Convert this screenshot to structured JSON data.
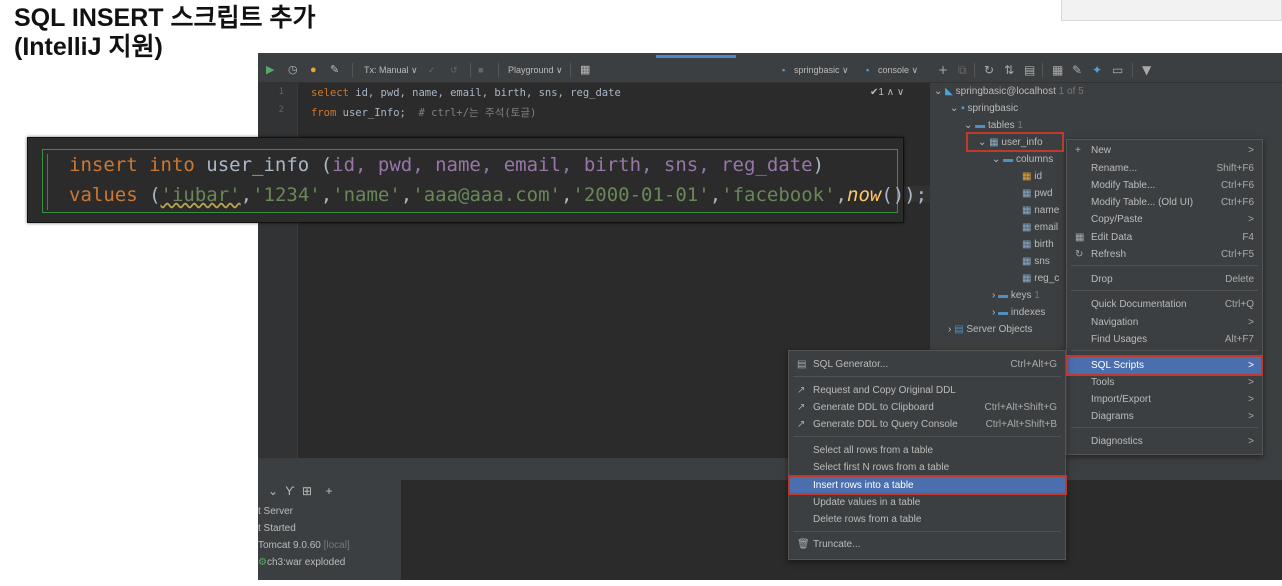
{
  "slide": {
    "title_line1": "SQL INSERT 스크립트 추가",
    "title_line2": "(IntelliJ 지원)"
  },
  "toolbar": {
    "tx_mode": "Tx: Manual ∨",
    "playground": "Playground ∨",
    "datasource": "springbasic ∨",
    "console": "console ∨"
  },
  "editor": {
    "line_numbers": [
      "1",
      "2"
    ],
    "line1": {
      "kw": "select",
      "rest": " id, pwd, name, email, birth, sns, reg_date"
    },
    "line2": {
      "kw": "from",
      "rest": " user_Info;  ",
      "comment": "# ctrl+/는 주석(토글)"
    },
    "inspection": "✔1 ∧ ∨"
  },
  "tree": {
    "connection": "springbasic@localhost",
    "connection_count": "1 of 5",
    "schema": "springbasic",
    "tables_label": "tables",
    "tables_count": "1",
    "table_name": "user_info",
    "columns_label": "columns",
    "columns": [
      "id",
      "pwd",
      "name",
      "email",
      "birth",
      "sns",
      "reg_c"
    ],
    "keys_label": "keys",
    "keys_count": "1",
    "indexes_label": "indexes",
    "server_objects": "Server Objects"
  },
  "services": {
    "rows": [
      "t Server",
      "t Started",
      "Tomcat 9.0.60",
      "[local]",
      "ch3:war exploded"
    ]
  },
  "context_menu": {
    "items": [
      {
        "label": "New",
        "shortcut": ">"
      },
      {
        "label": "Rename...",
        "shortcut": "Shift+F6"
      },
      {
        "label": "Modify Table...",
        "shortcut": "Ctrl+F6"
      },
      {
        "label": "Modify Table... (Old UI)",
        "shortcut": "Ctrl+F6"
      },
      {
        "label": "Copy/Paste",
        "shortcut": ">"
      },
      {
        "label": "Edit Data",
        "shortcut": "F4"
      },
      {
        "label": "Refresh",
        "shortcut": "Ctrl+F5"
      },
      {
        "label": "Drop",
        "shortcut": "Delete"
      },
      {
        "label": "Quick Documentation",
        "shortcut": "Ctrl+Q"
      },
      {
        "label": "Navigation",
        "shortcut": ">"
      },
      {
        "label": "Find Usages",
        "shortcut": "Alt+F7"
      },
      {
        "label": "SQL Scripts",
        "shortcut": ">"
      },
      {
        "label": "Tools",
        "shortcut": ">"
      },
      {
        "label": "Import/Export",
        "shortcut": ">"
      },
      {
        "label": "Diagrams",
        "shortcut": ">"
      },
      {
        "label": "Diagnostics",
        "shortcut": ">"
      }
    ]
  },
  "submenu": {
    "items": [
      {
        "label": "SQL Generator...",
        "shortcut": "Ctrl+Alt+G"
      },
      {
        "label": "Request and Copy Original DDL",
        "shortcut": ""
      },
      {
        "label": "Generate DDL to Clipboard",
        "shortcut": "Ctrl+Alt+Shift+G"
      },
      {
        "label": "Generate DDL to Query Console",
        "shortcut": "Ctrl+Alt+Shift+B"
      },
      {
        "label": "Select all rows from a table",
        "shortcut": ""
      },
      {
        "label": "Select first N rows from a table",
        "shortcut": ""
      },
      {
        "label": "Insert rows into a table",
        "shortcut": ""
      },
      {
        "label": "Update values in a table",
        "shortcut": ""
      },
      {
        "label": "Delete rows from a table",
        "shortcut": ""
      },
      {
        "label": "Truncate...",
        "shortcut": ""
      }
    ]
  },
  "zoom_code": {
    "line1": {
      "kw1": "insert",
      "kw2": "into",
      "table": " user_info ",
      "open": "(",
      "cols": "id, pwd, name, email, birth, sns, reg_date",
      "close": ")"
    },
    "line2": {
      "kw": "values",
      "open": " (",
      "v1": "'iubar'",
      "c1": ",",
      "v2": "'1234'",
      "c2": ",",
      "v3": "'name'",
      "c3": ",",
      "v4": "'aaa@aaa.com'",
      "c4": ",",
      "v5": "'2000-01-01'",
      "c5": ",",
      "v6": "'facebook'",
      "c6": ",",
      "fn": "now",
      "tail": "());"
    }
  }
}
